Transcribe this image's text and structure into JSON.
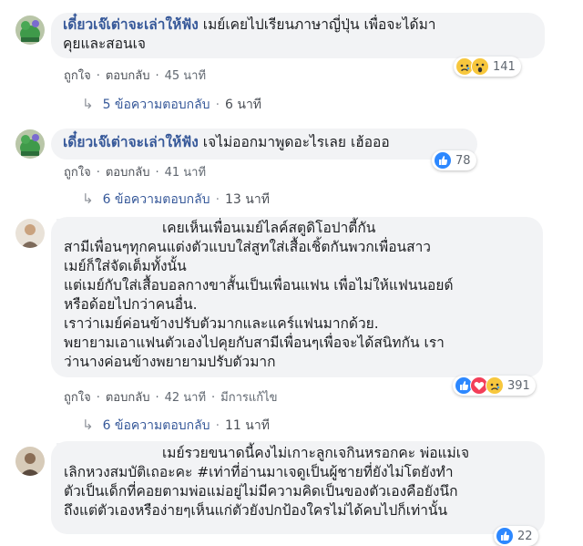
{
  "comments": [
    {
      "author": "เดี๋ยวเจ๊เต่าจะเล่าให้ฟัง",
      "lines": [
        "เมย์เคยไปเรียนภาษาญี่ปุ่น เพื่อจะได้มา",
        "คุยและสอนเจ"
      ],
      "like": "ถูกใจ",
      "reply": "ตอบกลับ",
      "time": "45 นาที",
      "reaction_count": "141",
      "replies": "5 ข้อความตอบกลับ",
      "replies_time": "6 นาที"
    },
    {
      "author": "เดี๋ยวเจ๊เต่าจะเล่าให้ฟัง",
      "lines": [
        "เจไม่ออกมาพูดอะไรเลย เฮ้อออ"
      ],
      "like": "ถูกใจ",
      "reply": "ตอบกลับ",
      "time": "41 นาที",
      "reaction_count": "78",
      "replies": "6 ข้อความตอบกลับ",
      "replies_time": "13 นาที"
    },
    {
      "lines": [
        "เคยเห็นเพื่อนเมย์ไลค์สตูดิโอปาตี้กัน",
        "สามีเพื่อนๆทุกคนแต่งตัวแบบใส่สูทใส่เสื้อเชิ้ตกันพวกเพื่อนสาว",
        "เมย์ก็ใส่จัดเต็มทั้งนั้น",
        "แต่เมย์กับใส่เสื้อบอลกางขาสั้นเป็นเพื่อนแฟน เพื่อไม่ให้แฟนนอยด์",
        "หรือด้อยไปกว่าคนอื่น.",
        "เราว่าเมย์ค่อนข้างปรับตัวมากและแคร์แฟนมากด้วย.",
        "พยายามเอาแฟนตัวเองไปคุยกับสามีเพื่อนๆเพื่อจะได้สนิทกัน เรา",
        "ว่านางค่อนข้างพยายามปรับตัวมาก"
      ],
      "like": "ถูกใจ",
      "reply": "ตอบกลับ",
      "time": "42 นาที",
      "edited": "มีการแก้ไข",
      "reaction_count": "391",
      "replies": "6 ข้อความตอบกลับ",
      "replies_time": "11 นาที"
    },
    {
      "lines": [
        "เมย์รวยขนาดนี้คงไม่เกาะลูกเจกินหรอกคะ พ่อแม่เจ",
        "เลิกหวงสมบัติเถอะคะ #เท่าที่อ่านมาเจดูเป็นผู้ชายที่ยังไม่โตยังทำ",
        "ตัวเป็นเด็กที่คอยตามพ่อแม่อยู่ไม่มีความคิดเป็นของตัวเองคือยังนึก",
        "ถึงแต่ตัวเองหรือง่ายๆเห็นแก่ตัวยังปกป้องใครไม่ได้คบไปก็เท่านั้น"
      ],
      "reaction_count": "22"
    }
  ],
  "colors": {
    "name": "#365899",
    "bubble": "#f2f3f5",
    "meta": "#606770"
  }
}
